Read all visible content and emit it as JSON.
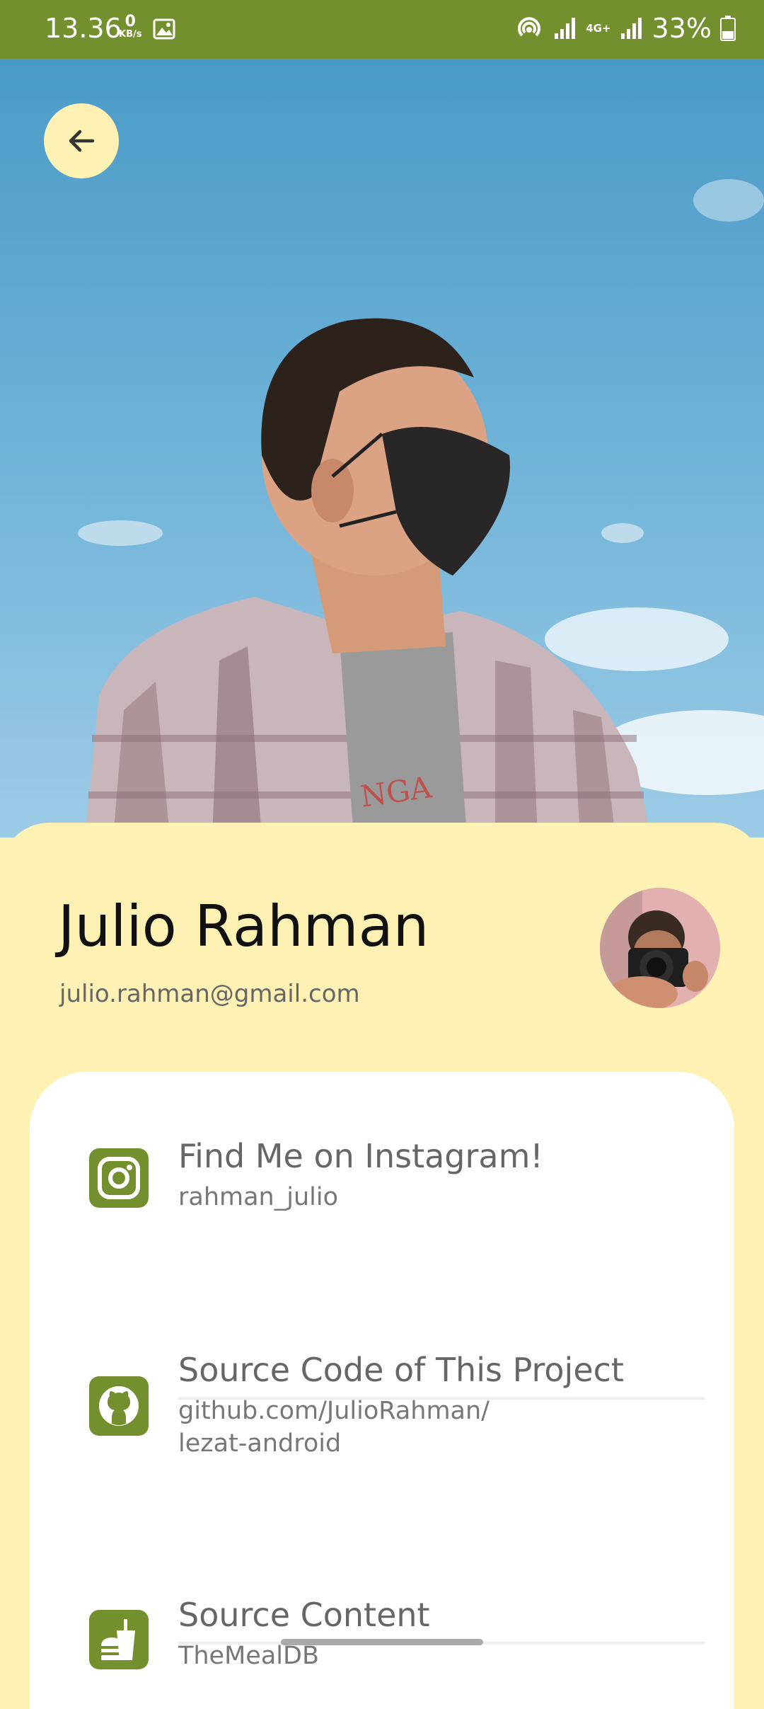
{
  "status_bar": {
    "time": "13.36",
    "net_speed_value": "0",
    "net_speed_unit": "KB/s",
    "network_label": "4G+",
    "battery": "33%"
  },
  "profile": {
    "name": "Julio Rahman",
    "email": "julio.rahman@gmail.com"
  },
  "links": [
    {
      "title": "Find Me on Instagram!",
      "subtitle": "rahman_julio",
      "icon": "instagram-icon"
    },
    {
      "title": "Source Code of This Project",
      "subtitle": "github.com/JulioRahman/\nlezat-android",
      "icon": "github-icon"
    },
    {
      "title": "Source Content",
      "subtitle": "TheMealDB",
      "icon": "food-icon"
    }
  ],
  "colors": {
    "accent_green": "#748f2e",
    "card_yellow": "#fdf2b3",
    "sky_blue": "#5ea8d2"
  }
}
